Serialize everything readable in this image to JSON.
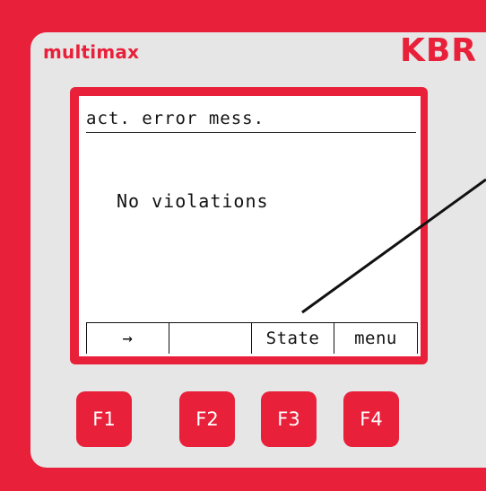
{
  "brand": {
    "product": "multimax",
    "maker": "KBR"
  },
  "display": {
    "title": "act. error mess.",
    "message": "No violations",
    "softkeys": [
      {
        "label": "→"
      },
      {
        "label": ""
      },
      {
        "label": "State"
      },
      {
        "label": "menu"
      }
    ]
  },
  "function_keys": [
    {
      "label": "F1"
    },
    {
      "label": "F2"
    },
    {
      "label": "F3"
    },
    {
      "label": "F4"
    }
  ],
  "colors": {
    "housing": "#e8203a",
    "panel": "#e6e6e6",
    "lcd": "#ffffff",
    "text": "#111111"
  }
}
